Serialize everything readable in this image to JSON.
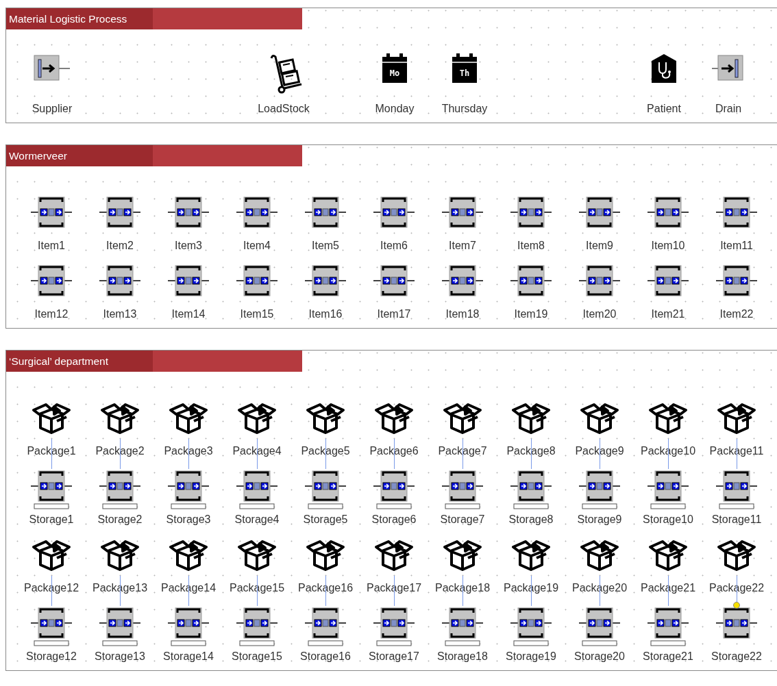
{
  "sections": [
    {
      "title": "Material Logistic Process",
      "nodes": [
        {
          "kind": "source",
          "label": "Supplier"
        },
        {
          "kind": "cart",
          "label": "LoadStock"
        },
        {
          "kind": "calendar",
          "day": "Mo",
          "label": "Monday"
        },
        {
          "kind": "calendar",
          "day": "Th",
          "label": "Thursday"
        },
        {
          "kind": "patient",
          "label": "Patient"
        },
        {
          "kind": "sink",
          "label": "Drain"
        }
      ]
    },
    {
      "title": "Wormerveer",
      "rows": [
        [
          {
            "kind": "queue",
            "label": "Item1"
          },
          {
            "kind": "queue",
            "label": "Item2"
          },
          {
            "kind": "queue",
            "label": "Item3"
          },
          {
            "kind": "queue",
            "label": "Item4"
          },
          {
            "kind": "queue",
            "label": "Item5"
          },
          {
            "kind": "queue",
            "label": "Item6"
          },
          {
            "kind": "queue",
            "label": "Item7"
          },
          {
            "kind": "queue",
            "label": "Item8"
          },
          {
            "kind": "queue",
            "label": "Item9"
          },
          {
            "kind": "queue",
            "label": "Item10"
          },
          {
            "kind": "queue",
            "label": "Item11"
          }
        ],
        [
          {
            "kind": "queue",
            "label": "Item12"
          },
          {
            "kind": "queue",
            "label": "Item13"
          },
          {
            "kind": "queue",
            "label": "Item14"
          },
          {
            "kind": "queue",
            "label": "Item15"
          },
          {
            "kind": "queue",
            "label": "Item16"
          },
          {
            "kind": "queue",
            "label": "Item17"
          },
          {
            "kind": "queue",
            "label": "Item18"
          },
          {
            "kind": "queue",
            "label": "Item19"
          },
          {
            "kind": "queue",
            "label": "Item20"
          },
          {
            "kind": "queue",
            "label": "Item21"
          },
          {
            "kind": "queue",
            "label": "Item22"
          }
        ]
      ]
    },
    {
      "title": "‘Surgical’ department",
      "rows": [
        [
          {
            "kind": "package",
            "label": "Package1",
            "linked": true
          },
          {
            "kind": "package",
            "label": "Package2",
            "linked": true
          },
          {
            "kind": "package",
            "label": "Package3",
            "linked": true
          },
          {
            "kind": "package",
            "label": "Package4",
            "linked": true
          },
          {
            "kind": "package",
            "label": "Package5",
            "linked": true
          },
          {
            "kind": "package",
            "label": "Package6",
            "linked": true
          },
          {
            "kind": "package",
            "label": "Package7",
            "linked": true
          },
          {
            "kind": "package",
            "label": "Package8",
            "linked": true
          },
          {
            "kind": "package",
            "label": "Package9",
            "linked": true
          },
          {
            "kind": "package",
            "label": "Package10",
            "linked": true
          },
          {
            "kind": "package",
            "label": "Package11",
            "linked": true
          }
        ],
        [
          {
            "kind": "storage",
            "label": "Storage1",
            "base": true,
            "selected": false
          },
          {
            "kind": "storage",
            "label": "Storage2",
            "base": true,
            "selected": false
          },
          {
            "kind": "storage",
            "label": "Storage3",
            "base": true,
            "selected": false
          },
          {
            "kind": "storage",
            "label": "Storage4",
            "base": true,
            "selected": false
          },
          {
            "kind": "storage",
            "label": "Storage5",
            "base": true,
            "selected": false
          },
          {
            "kind": "storage",
            "label": "Storage6",
            "base": true,
            "selected": false
          },
          {
            "kind": "storage",
            "label": "Storage7",
            "base": true,
            "selected": false
          },
          {
            "kind": "storage",
            "label": "Storage8",
            "base": true,
            "selected": false
          },
          {
            "kind": "storage",
            "label": "Storage9",
            "base": true,
            "selected": false
          },
          {
            "kind": "storage",
            "label": "Storage10",
            "base": true,
            "selected": false
          },
          {
            "kind": "storage",
            "label": "Storage11",
            "base": true,
            "selected": false
          }
        ],
        [
          {
            "kind": "package",
            "label": "Package12",
            "linked": true
          },
          {
            "kind": "package",
            "label": "Package13",
            "linked": true
          },
          {
            "kind": "package",
            "label": "Package14",
            "linked": true
          },
          {
            "kind": "package",
            "label": "Package15",
            "linked": true
          },
          {
            "kind": "package",
            "label": "Package16",
            "linked": true
          },
          {
            "kind": "package",
            "label": "Package17",
            "linked": true
          },
          {
            "kind": "package",
            "label": "Package18",
            "linked": true
          },
          {
            "kind": "package",
            "label": "Package19",
            "linked": true
          },
          {
            "kind": "package",
            "label": "Package20",
            "linked": true
          },
          {
            "kind": "package",
            "label": "Package21",
            "linked": true
          },
          {
            "kind": "package",
            "label": "Package22",
            "linked": true
          }
        ],
        [
          {
            "kind": "storage",
            "label": "Storage12",
            "base": true,
            "selected": false
          },
          {
            "kind": "storage",
            "label": "Storage13",
            "base": true,
            "selected": false
          },
          {
            "kind": "storage",
            "label": "Storage14",
            "base": true,
            "selected": false
          },
          {
            "kind": "storage",
            "label": "Storage15",
            "base": true,
            "selected": false
          },
          {
            "kind": "storage",
            "label": "Storage16",
            "base": true,
            "selected": false
          },
          {
            "kind": "storage",
            "label": "Storage17",
            "base": true,
            "selected": false
          },
          {
            "kind": "storage",
            "label": "Storage18",
            "base": true,
            "selected": false
          },
          {
            "kind": "storage",
            "label": "Storage19",
            "base": true,
            "selected": false
          },
          {
            "kind": "storage",
            "label": "Storage20",
            "base": true,
            "selected": false
          },
          {
            "kind": "storage",
            "label": "Storage21",
            "base": true,
            "selected": false
          },
          {
            "kind": "storage",
            "label": "Storage22",
            "base": false,
            "selected": true
          }
        ]
      ]
    }
  ]
}
